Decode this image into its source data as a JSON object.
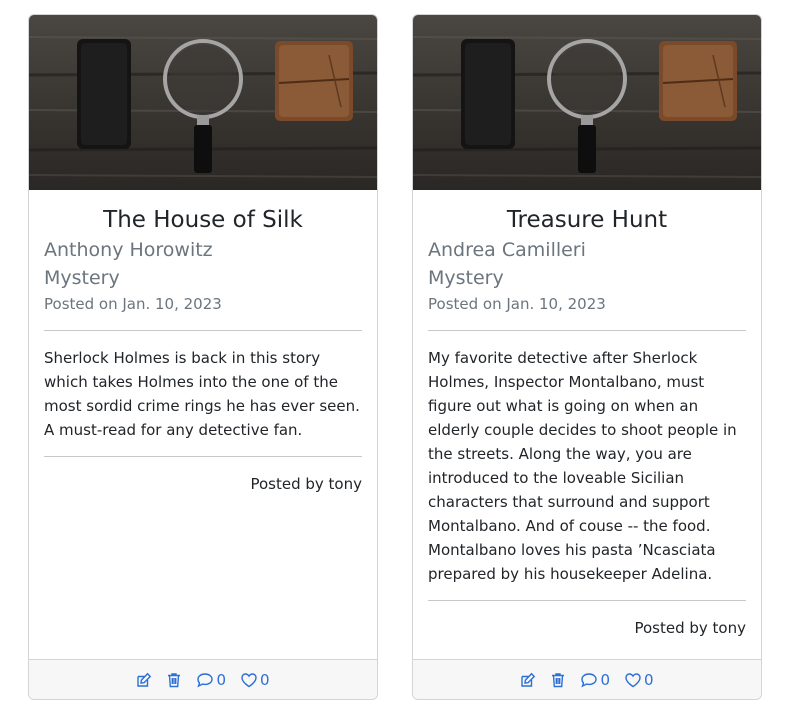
{
  "posts": [
    {
      "title": "The House of Silk",
      "author": "Anthony Horowitz",
      "genre": "Mystery",
      "posted_on": "Posted on Jan. 10, 2023",
      "description": "Sherlock Holmes is back in this story which takes Holmes into the one of the most sordid crime rings he has ever seen. A must-read for any detective fan.",
      "posted_by": "Posted by tony",
      "comment_count": "0",
      "like_count": "0",
      "image_icons": [
        "smartphone-icon",
        "magnifying-glass-icon",
        "notebook-icon"
      ]
    },
    {
      "title": "Treasure Hunt",
      "author": "Andrea Camilleri",
      "genre": "Mystery",
      "posted_on": "Posted on Jan. 10, 2023",
      "description": "My favorite detective after Sherlock Holmes, Inspector Montalbano, must figure out what is going on when an elderly couple decides to shoot people in the streets. Along the way, you are introduced to the loveable Sicilian characters that surround and support Montalbano. And of couse -- the food. Montalbano loves his pasta ’Ncasciata prepared by his housekeeper Adelina.",
      "posted_by": "Posted by tony",
      "comment_count": "0",
      "like_count": "0",
      "image_icons": [
        "smartphone-icon",
        "magnifying-glass-icon",
        "notebook-icon"
      ]
    }
  ],
  "footer_icons": [
    "edit-icon",
    "trash-icon",
    "comment-icon",
    "heart-icon"
  ],
  "colors": {
    "accent": "#2c6fd6",
    "muted_text": "#6c757d",
    "border": "#d2d4d7",
    "footer_bg": "#f7f7f7"
  }
}
